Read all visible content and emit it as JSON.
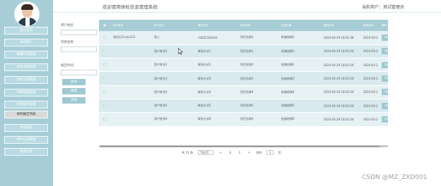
{
  "header": {
    "app_title": "欢迎使用体检信息管理系统",
    "user_info": "当前用户：测试管理员"
  },
  "sidebar": {
    "items": [
      {
        "label": "后台首页"
      },
      {
        "label": "体检用户"
      },
      {
        "label": "健康科普管理"
      },
      {
        "label": "体检项目管理"
      },
      {
        "label": "体检方式管理"
      },
      {
        "label": "项目类型管理"
      },
      {
        "label": "体检报告管理"
      },
      {
        "label": "体检报告列表"
      },
      {
        "label": "系统管理"
      },
      {
        "label": "预约记录管理"
      },
      {
        "label": "我的信息"
      }
    ],
    "active_index": 7
  },
  "filter": {
    "user_name_label": "用户姓名",
    "project_name_label": "项目名称",
    "report_time_label": "报告时间",
    "query_label": "查询",
    "reset_label": "重置",
    "add_label": "添加"
  },
  "table": {
    "columns": [
      "用户账号",
      "用户姓名",
      "联系方式",
      "项目名称",
      "检查结果",
      "报告时间",
      "更新时间",
      "操作"
    ],
    "rows": [
      [
        "测试123-ass123",
        "张三",
        "13832165421",
        "项目名称2",
        "检查结果2",
        "2024-03-29 18:01:38",
        "2024-03-29 18:0",
        "详情"
      ],
      [
        "",
        "用户姓名1",
        "联系方式1",
        "项目名称1",
        "检查结果1",
        "2024-03-29 18:02:26",
        "2024-03-29 18:0",
        "详情"
      ],
      [
        "",
        "用户姓名2",
        "联系方式2",
        "项目名称2",
        "检查结果2",
        "2024-03-29 18:02:26",
        "2024-03-29 18:0",
        "详情"
      ],
      [
        "",
        "用户姓名3",
        "联系方式3",
        "项目名称3",
        "检查结果3",
        "2024-03-29 18:02:26",
        "2024-03-29 18:0",
        "详情"
      ],
      [
        "",
        "用户姓名4",
        "联系方式4",
        "项目名称4",
        "检查结果4",
        "2024-03-29 18:02:26",
        "2024-03-29 18:0",
        "详情"
      ],
      [
        "",
        "用户姓名5",
        "联系方式5",
        "项目名称5",
        "检查结果5",
        "2024-03-29 18:02:26",
        "2024-03-29 18:0",
        "详情"
      ],
      [
        "",
        "用户姓名6",
        "联系方式6",
        "项目名称6",
        "检查结果6",
        "2024-03-29 18:02:26",
        "2024-03-29 18:0",
        "详情"
      ]
    ]
  },
  "pager": {
    "total": "共 11 条",
    "page_size": "7条/页",
    "prev": "<",
    "pages": [
      "1",
      "2"
    ],
    "current": "1",
    "next": ">",
    "goto_label": "前往",
    "goto_value": "1",
    "page_suffix": "页"
  },
  "watermark": "CSDN @MZ_ZXD001",
  "colors": {
    "accent": "#a7cdd6",
    "button": "#9ec9d2",
    "row": "#e6f1f4",
    "row_alt": "#d9eaef",
    "active_nav": "#d9d9d9"
  }
}
